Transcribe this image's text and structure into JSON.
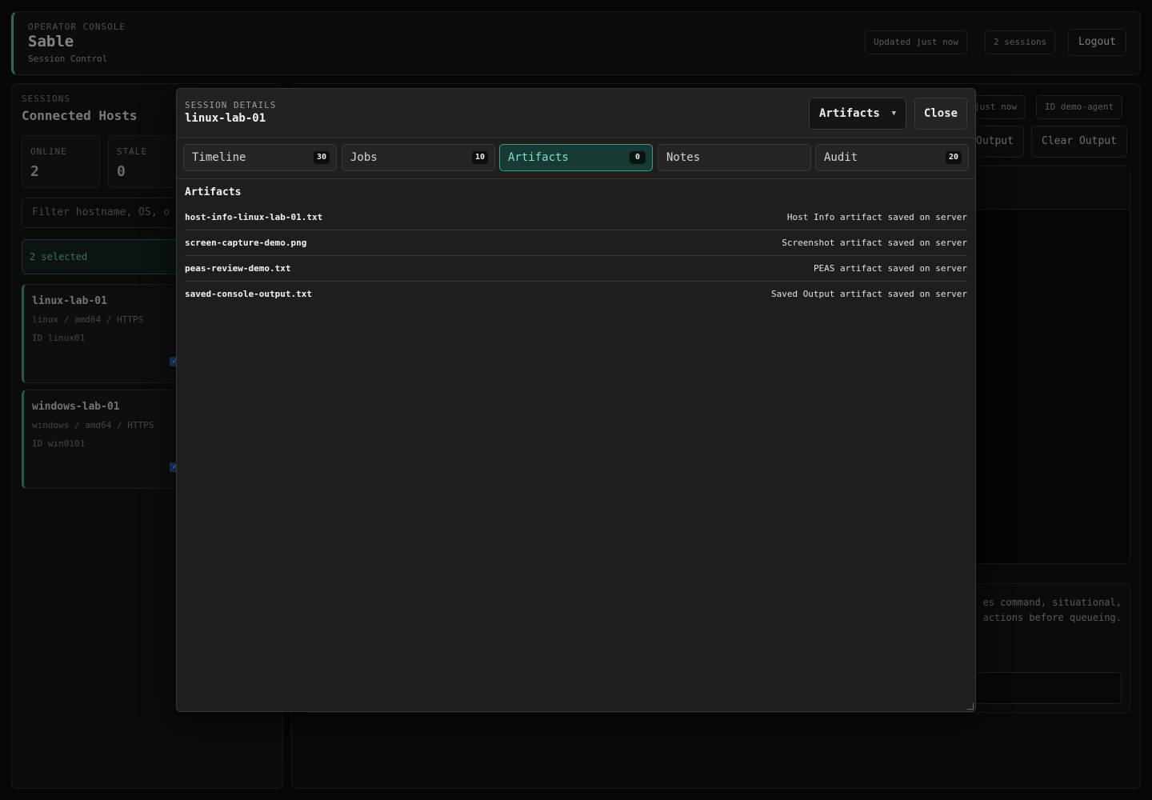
{
  "header": {
    "kicker": "OPERATOR CONSOLE",
    "brand": "Sable",
    "subtitle": "Session Control",
    "updated": "Updated just now",
    "sessions": "2 sessions",
    "logout": "Logout"
  },
  "sidebar": {
    "kicker": "SESSIONS",
    "title": "Connected Hosts",
    "stats": [
      {
        "label": "ONLINE",
        "value": "2"
      },
      {
        "label": "STALE",
        "value": "0"
      }
    ],
    "filter_placeholder": "Filter hostname, OS, o",
    "selected": "2 selected",
    "hosts": [
      {
        "name": "linux-lab-01",
        "meta": "linux / amd64 / HTTPS",
        "id": "ID linux01",
        "checked": true
      },
      {
        "name": "windows-lab-01",
        "meta": "windows / amd64 / HTTPS",
        "id": "ID win0101",
        "checked": true
      }
    ]
  },
  "main": {
    "updated_partial": "just now",
    "agent_id": "ID demo-agent",
    "save_output_partial": "Output",
    "clear_output": "Clear Output",
    "desc_line1": "es command, situational,",
    "desc_line2": "actions before queueing."
  },
  "modal": {
    "kicker": "SESSION DETAILS",
    "title": "linux-lab-01",
    "select_value": "Artifacts",
    "close_label": "Close",
    "tabs": [
      {
        "label": "Timeline",
        "count": "30",
        "active": false
      },
      {
        "label": "Jobs",
        "count": "10",
        "active": false
      },
      {
        "label": "Artifacts",
        "count": "0",
        "active": true
      },
      {
        "label": "Notes",
        "count": "",
        "active": false
      },
      {
        "label": "Audit",
        "count": "20",
        "active": false
      }
    ],
    "section_title": "Artifacts",
    "artifacts": [
      {
        "file": "host-info-linux-lab-01.txt",
        "desc": "Host Info artifact saved on server"
      },
      {
        "file": "screen-capture-demo.png",
        "desc": "Screenshot artifact saved on server"
      },
      {
        "file": "peas-review-demo.txt",
        "desc": "PEAS artifact saved on server"
      },
      {
        "file": "saved-console-output.txt",
        "desc": "Saved Output artifact saved on server"
      }
    ]
  },
  "colors": {
    "accent": "#3f9a86",
    "modal_bg": "#1e1e1c",
    "page_bg": "#060606"
  },
  "icons": {
    "select_caret": "caret-down-icon",
    "check": "check-icon",
    "resize": "resize-grip-icon"
  }
}
